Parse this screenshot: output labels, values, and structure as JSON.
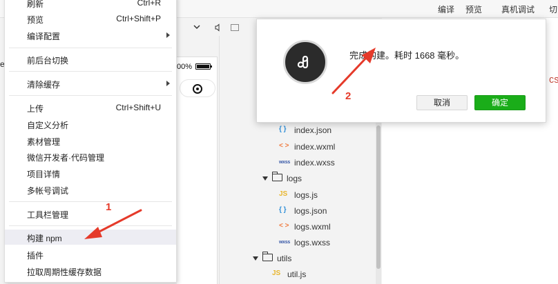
{
  "toolbar": {
    "compile": "编译",
    "preview": "预览",
    "real_debug": "真机调试",
    "cut": "切"
  },
  "phone": {
    "battery_text": "00%",
    "battery_level": 1.0
  },
  "left_strip_text": "e",
  "editor_fragment": "CS",
  "menu": {
    "items": [
      {
        "label": "刷新",
        "shortcut": "Ctrl+R"
      },
      {
        "label": "预览",
        "shortcut": "Ctrl+Shift+P"
      },
      {
        "label": "编译配置",
        "submenu": true
      },
      {
        "label": "前后台切换"
      },
      {
        "label": "清除缓存",
        "submenu": true
      },
      {
        "label": "上传",
        "shortcut": "Ctrl+Shift+U"
      },
      {
        "label": "自定义分析"
      },
      {
        "label": "素材管理"
      },
      {
        "label": "微信开发者·代码管理"
      },
      {
        "label": "项目详情"
      },
      {
        "label": "多帐号调试"
      },
      {
        "label": "工具栏管理"
      },
      {
        "label": "构建 npm",
        "highlighted": true
      },
      {
        "label": "插件"
      },
      {
        "label": "拉取周期性缓存数据"
      }
    ]
  },
  "dialog": {
    "message": "完成构建。耗时 1668 毫秒。",
    "cancel": "取消",
    "ok": "确定"
  },
  "file_tree": [
    {
      "icon": "json",
      "icon_text": "{ }",
      "name": "index.json"
    },
    {
      "icon": "wxml",
      "icon_text": "< >",
      "name": "index.wxml"
    },
    {
      "icon": "wxss",
      "icon_text": "wxss",
      "name": "index.wxss"
    },
    {
      "icon": "folder",
      "name": "logs"
    },
    {
      "icon": "js",
      "icon_text": "JS",
      "name": "logs.js"
    },
    {
      "icon": "json",
      "icon_text": "{ }",
      "name": "logs.json"
    },
    {
      "icon": "wxml",
      "icon_text": "< >",
      "name": "logs.wxml"
    },
    {
      "icon": "wxss",
      "icon_text": "wxss",
      "name": "logs.wxss"
    },
    {
      "icon": "folder",
      "name": "utils"
    },
    {
      "icon": "js",
      "icon_text": "JS",
      "name": "util.js"
    }
  ],
  "annotations": {
    "label_1": "1",
    "label_2": "2"
  },
  "colors": {
    "ok_button": "#1aad19",
    "annotation": "#e53a2a",
    "logo_bg": "#2b2b2b"
  }
}
